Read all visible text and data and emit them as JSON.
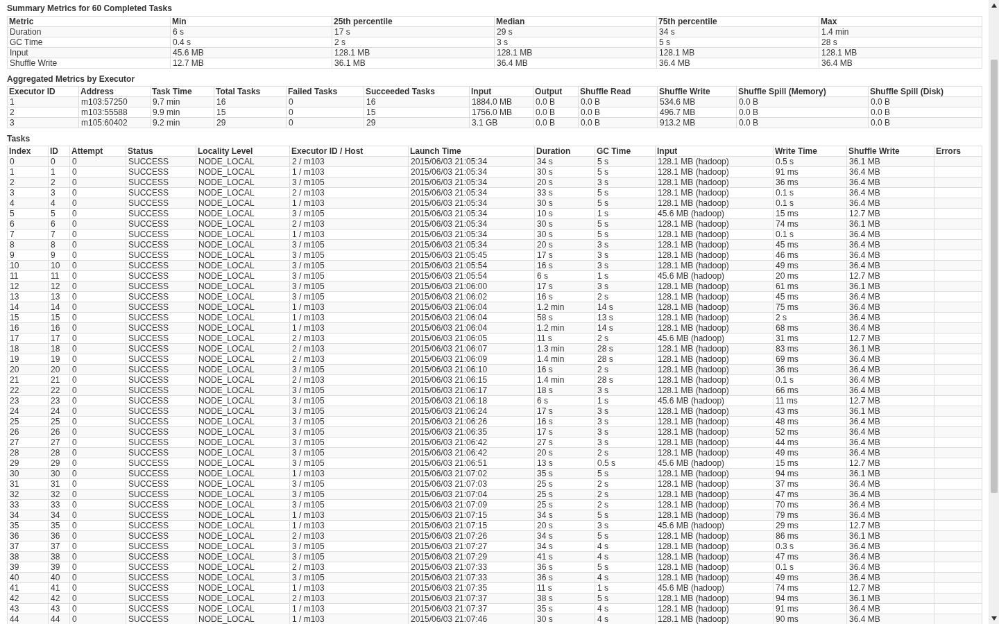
{
  "summary_metrics": {
    "title": "Summary Metrics for 60 Completed Tasks",
    "columns": [
      "Metric",
      "Min",
      "25th percentile",
      "Median",
      "75th percentile",
      "Max"
    ],
    "rows": [
      [
        "Duration",
        "6 s",
        "17 s",
        "29 s",
        "34 s",
        "1.4 min"
      ],
      [
        "GC Time",
        "0.4 s",
        "2 s",
        "3 s",
        "5 s",
        "28 s"
      ],
      [
        "Input",
        "45.6 MB",
        "128.1 MB",
        "128.1 MB",
        "128.1 MB",
        "128.1 MB"
      ],
      [
        "Shuffle Write",
        "12.7 MB",
        "36.1 MB",
        "36.4 MB",
        "36.4 MB",
        "36.4 MB"
      ]
    ]
  },
  "executor_metrics": {
    "title": "Aggregated Metrics by Executor",
    "columns": [
      "Executor ID",
      "Address",
      "Task Time",
      "Total Tasks",
      "Failed Tasks",
      "Succeeded Tasks",
      "Input",
      "Output",
      "Shuffle Read",
      "Shuffle Write",
      "Shuffle Spill (Memory)",
      "Shuffle Spill (Disk)"
    ],
    "rows": [
      [
        "1",
        "m103:57250",
        "9.7 min",
        "16",
        "0",
        "16",
        "1884.0 MB",
        "0.0 B",
        "0.0 B",
        "534.6 MB",
        "0.0 B",
        "0.0 B"
      ],
      [
        "2",
        "m103:55588",
        "9.9 min",
        "15",
        "0",
        "15",
        "1756.0 MB",
        "0.0 B",
        "0.0 B",
        "496.7 MB",
        "0.0 B",
        "0.0 B"
      ],
      [
        "3",
        "m105:60402",
        "9.2 min",
        "29",
        "0",
        "29",
        "3.1 GB",
        "0.0 B",
        "0.0 B",
        "913.2 MB",
        "0.0 B",
        "0.0 B"
      ]
    ]
  },
  "tasks": {
    "title": "Tasks",
    "columns": [
      "Index",
      "ID",
      "Attempt",
      "Status",
      "Locality Level",
      "Executor ID / Host",
      "Launch Time",
      "Duration",
      "GC Time",
      "Input",
      "Write Time",
      "Shuffle Write",
      "Errors"
    ],
    "rows": [
      [
        "0",
        "0",
        "0",
        "SUCCESS",
        "NODE_LOCAL",
        "2 / m103",
        "2015/06/03 21:05:34",
        "34 s",
        "5 s",
        "128.1 MB (hadoop)",
        "0.5 s",
        "36.1 MB"
      ],
      [
        "1",
        "1",
        "0",
        "SUCCESS",
        "NODE_LOCAL",
        "1 / m103",
        "2015/06/03 21:05:34",
        "30 s",
        "5 s",
        "128.1 MB (hadoop)",
        "91 ms",
        "36.4 MB"
      ],
      [
        "2",
        "2",
        "0",
        "SUCCESS",
        "NODE_LOCAL",
        "3 / m105",
        "2015/06/03 21:05:34",
        "20 s",
        "3 s",
        "128.1 MB (hadoop)",
        "36 ms",
        "36.4 MB"
      ],
      [
        "3",
        "3",
        "0",
        "SUCCESS",
        "NODE_LOCAL",
        "2 / m103",
        "2015/06/03 21:05:34",
        "33 s",
        "5 s",
        "128.1 MB (hadoop)",
        "0.1 s",
        "36.4 MB"
      ],
      [
        "4",
        "4",
        "0",
        "SUCCESS",
        "NODE_LOCAL",
        "1 / m103",
        "2015/06/03 21:05:34",
        "30 s",
        "5 s",
        "128.1 MB (hadoop)",
        "0.1 s",
        "36.4 MB"
      ],
      [
        "5",
        "5",
        "0",
        "SUCCESS",
        "NODE_LOCAL",
        "3 / m105",
        "2015/06/03 21:05:34",
        "10 s",
        "1 s",
        "45.6 MB (hadoop)",
        "15 ms",
        "12.7 MB"
      ],
      [
        "6",
        "6",
        "0",
        "SUCCESS",
        "NODE_LOCAL",
        "2 / m103",
        "2015/06/03 21:05:34",
        "30 s",
        "5 s",
        "128.1 MB (hadoop)",
        "74 ms",
        "36.1 MB"
      ],
      [
        "7",
        "7",
        "0",
        "SUCCESS",
        "NODE_LOCAL",
        "1 / m103",
        "2015/06/03 21:05:34",
        "30 s",
        "5 s",
        "128.1 MB (hadoop)",
        "0.1 s",
        "36.4 MB"
      ],
      [
        "8",
        "8",
        "0",
        "SUCCESS",
        "NODE_LOCAL",
        "3 / m105",
        "2015/06/03 21:05:34",
        "20 s",
        "3 s",
        "128.1 MB (hadoop)",
        "45 ms",
        "36.4 MB"
      ],
      [
        "9",
        "9",
        "0",
        "SUCCESS",
        "NODE_LOCAL",
        "3 / m105",
        "2015/06/03 21:05:45",
        "17 s",
        "3 s",
        "128.1 MB (hadoop)",
        "46 ms",
        "36.4 MB"
      ],
      [
        "10",
        "10",
        "0",
        "SUCCESS",
        "NODE_LOCAL",
        "3 / m105",
        "2015/06/03 21:05:54",
        "16 s",
        "3 s",
        "128.1 MB (hadoop)",
        "49 ms",
        "36.4 MB"
      ],
      [
        "11",
        "11",
        "0",
        "SUCCESS",
        "NODE_LOCAL",
        "3 / m105",
        "2015/06/03 21:05:54",
        "6 s",
        "1 s",
        "45.6 MB (hadoop)",
        "20 ms",
        "12.7 MB"
      ],
      [
        "12",
        "12",
        "0",
        "SUCCESS",
        "NODE_LOCAL",
        "3 / m105",
        "2015/06/03 21:06:00",
        "17 s",
        "3 s",
        "128.1 MB (hadoop)",
        "61 ms",
        "36.1 MB"
      ],
      [
        "13",
        "13",
        "0",
        "SUCCESS",
        "NODE_LOCAL",
        "3 / m105",
        "2015/06/03 21:06:02",
        "16 s",
        "2 s",
        "128.1 MB (hadoop)",
        "45 ms",
        "36.4 MB"
      ],
      [
        "14",
        "14",
        "0",
        "SUCCESS",
        "NODE_LOCAL",
        "1 / m103",
        "2015/06/03 21:06:04",
        "1.2 min",
        "14 s",
        "128.1 MB (hadoop)",
        "75 ms",
        "36.4 MB"
      ],
      [
        "15",
        "15",
        "0",
        "SUCCESS",
        "NODE_LOCAL",
        "1 / m103",
        "2015/06/03 21:06:04",
        "58 s",
        "13 s",
        "128.1 MB (hadoop)",
        "2 s",
        "36.4 MB"
      ],
      [
        "16",
        "16",
        "0",
        "SUCCESS",
        "NODE_LOCAL",
        "1 / m103",
        "2015/06/03 21:06:04",
        "1.2 min",
        "14 s",
        "128.1 MB (hadoop)",
        "68 ms",
        "36.4 MB"
      ],
      [
        "17",
        "17",
        "0",
        "SUCCESS",
        "NODE_LOCAL",
        "2 / m103",
        "2015/06/03 21:06:05",
        "11 s",
        "2 s",
        "45.6 MB (hadoop)",
        "31 ms",
        "12.7 MB"
      ],
      [
        "18",
        "18",
        "0",
        "SUCCESS",
        "NODE_LOCAL",
        "2 / m103",
        "2015/06/03 21:06:07",
        "1.3 min",
        "28 s",
        "128.1 MB (hadoop)",
        "83 ms",
        "36.1 MB"
      ],
      [
        "19",
        "19",
        "0",
        "SUCCESS",
        "NODE_LOCAL",
        "2 / m103",
        "2015/06/03 21:06:09",
        "1.4 min",
        "28 s",
        "128.1 MB (hadoop)",
        "69 ms",
        "36.4 MB"
      ],
      [
        "20",
        "20",
        "0",
        "SUCCESS",
        "NODE_LOCAL",
        "3 / m105",
        "2015/06/03 21:06:10",
        "16 s",
        "2 s",
        "128.1 MB (hadoop)",
        "36 ms",
        "36.4 MB"
      ],
      [
        "21",
        "21",
        "0",
        "SUCCESS",
        "NODE_LOCAL",
        "2 / m103",
        "2015/06/03 21:06:15",
        "1.4 min",
        "28 s",
        "128.1 MB (hadoop)",
        "0.1 s",
        "36.4 MB"
      ],
      [
        "22",
        "22",
        "0",
        "SUCCESS",
        "NODE_LOCAL",
        "3 / m105",
        "2015/06/03 21:06:17",
        "18 s",
        "3 s",
        "128.1 MB (hadoop)",
        "66 ms",
        "36.4 MB"
      ],
      [
        "23",
        "23",
        "0",
        "SUCCESS",
        "NODE_LOCAL",
        "3 / m105",
        "2015/06/03 21:06:18",
        "6 s",
        "1 s",
        "45.6 MB (hadoop)",
        "11 ms",
        "12.7 MB"
      ],
      [
        "24",
        "24",
        "0",
        "SUCCESS",
        "NODE_LOCAL",
        "3 / m105",
        "2015/06/03 21:06:24",
        "17 s",
        "3 s",
        "128.1 MB (hadoop)",
        "43 ms",
        "36.1 MB"
      ],
      [
        "25",
        "25",
        "0",
        "SUCCESS",
        "NODE_LOCAL",
        "3 / m105",
        "2015/06/03 21:06:26",
        "16 s",
        "3 s",
        "128.1 MB (hadoop)",
        "48 ms",
        "36.4 MB"
      ],
      [
        "26",
        "26",
        "0",
        "SUCCESS",
        "NODE_LOCAL",
        "3 / m105",
        "2015/06/03 21:06:35",
        "17 s",
        "3 s",
        "128.1 MB (hadoop)",
        "52 ms",
        "36.4 MB"
      ],
      [
        "27",
        "27",
        "0",
        "SUCCESS",
        "NODE_LOCAL",
        "3 / m105",
        "2015/06/03 21:06:42",
        "27 s",
        "3 s",
        "128.1 MB (hadoop)",
        "44 ms",
        "36.4 MB"
      ],
      [
        "28",
        "28",
        "0",
        "SUCCESS",
        "NODE_LOCAL",
        "3 / m105",
        "2015/06/03 21:06:42",
        "20 s",
        "2 s",
        "128.1 MB (hadoop)",
        "49 ms",
        "36.4 MB"
      ],
      [
        "29",
        "29",
        "0",
        "SUCCESS",
        "NODE_LOCAL",
        "3 / m105",
        "2015/06/03 21:06:51",
        "13 s",
        "0.5 s",
        "45.6 MB (hadoop)",
        "15 ms",
        "12.7 MB"
      ],
      [
        "30",
        "30",
        "0",
        "SUCCESS",
        "NODE_LOCAL",
        "1 / m103",
        "2015/06/03 21:07:02",
        "35 s",
        "5 s",
        "128.1 MB (hadoop)",
        "94 ms",
        "36.1 MB"
      ],
      [
        "31",
        "31",
        "0",
        "SUCCESS",
        "NODE_LOCAL",
        "3 / m105",
        "2015/06/03 21:07:03",
        "25 s",
        "2 s",
        "128.1 MB (hadoop)",
        "37 ms",
        "36.4 MB"
      ],
      [
        "32",
        "32",
        "0",
        "SUCCESS",
        "NODE_LOCAL",
        "3 / m105",
        "2015/06/03 21:07:04",
        "25 s",
        "2 s",
        "128.1 MB (hadoop)",
        "47 ms",
        "36.4 MB"
      ],
      [
        "33",
        "33",
        "0",
        "SUCCESS",
        "NODE_LOCAL",
        "3 / m105",
        "2015/06/03 21:07:09",
        "25 s",
        "2 s",
        "128.1 MB (hadoop)",
        "70 ms",
        "36.4 MB"
      ],
      [
        "34",
        "34",
        "0",
        "SUCCESS",
        "NODE_LOCAL",
        "1 / m103",
        "2015/06/03 21:07:15",
        "34 s",
        "5 s",
        "128.1 MB (hadoop)",
        "79 ms",
        "36.4 MB"
      ],
      [
        "35",
        "35",
        "0",
        "SUCCESS",
        "NODE_LOCAL",
        "1 / m103",
        "2015/06/03 21:07:15",
        "20 s",
        "3 s",
        "45.6 MB (hadoop)",
        "29 ms",
        "12.7 MB"
      ],
      [
        "36",
        "36",
        "0",
        "SUCCESS",
        "NODE_LOCAL",
        "2 / m103",
        "2015/06/03 21:07:26",
        "34 s",
        "5 s",
        "128.1 MB (hadoop)",
        "86 ms",
        "36.1 MB"
      ],
      [
        "37",
        "37",
        "0",
        "SUCCESS",
        "NODE_LOCAL",
        "3 / m105",
        "2015/06/03 21:07:27",
        "34 s",
        "4 s",
        "128.1 MB (hadoop)",
        "0.3 s",
        "36.4 MB"
      ],
      [
        "38",
        "38",
        "0",
        "SUCCESS",
        "NODE_LOCAL",
        "3 / m105",
        "2015/06/03 21:07:29",
        "41 s",
        "4 s",
        "128.1 MB (hadoop)",
        "47 ms",
        "36.4 MB"
      ],
      [
        "39",
        "39",
        "0",
        "SUCCESS",
        "NODE_LOCAL",
        "2 / m103",
        "2015/06/03 21:07:33",
        "36 s",
        "5 s",
        "128.1 MB (hadoop)",
        "0.1 s",
        "36.4 MB"
      ],
      [
        "40",
        "40",
        "0",
        "SUCCESS",
        "NODE_LOCAL",
        "3 / m105",
        "2015/06/03 21:07:33",
        "36 s",
        "4 s",
        "128.1 MB (hadoop)",
        "49 ms",
        "36.4 MB"
      ],
      [
        "41",
        "41",
        "0",
        "SUCCESS",
        "NODE_LOCAL",
        "1 / m103",
        "2015/06/03 21:07:35",
        "11 s",
        "1 s",
        "45.6 MB (hadoop)",
        "74 ms",
        "12.7 MB"
      ],
      [
        "42",
        "42",
        "0",
        "SUCCESS",
        "NODE_LOCAL",
        "2 / m103",
        "2015/06/03 21:07:37",
        "38 s",
        "5 s",
        "128.1 MB (hadoop)",
        "94 ms",
        "36.1 MB"
      ],
      [
        "43",
        "43",
        "0",
        "SUCCESS",
        "NODE_LOCAL",
        "1 / m103",
        "2015/06/03 21:07:37",
        "35 s",
        "4 s",
        "128.1 MB (hadoop)",
        "91 ms",
        "36.4 MB"
      ],
      [
        "44",
        "44",
        "0",
        "SUCCESS",
        "NODE_LOCAL",
        "1 / m103",
        "2015/06/03 21:07:46",
        "30 s",
        "4 s",
        "128.1 MB (hadoop)",
        "90 ms",
        "36.4 MB"
      ]
    ]
  }
}
